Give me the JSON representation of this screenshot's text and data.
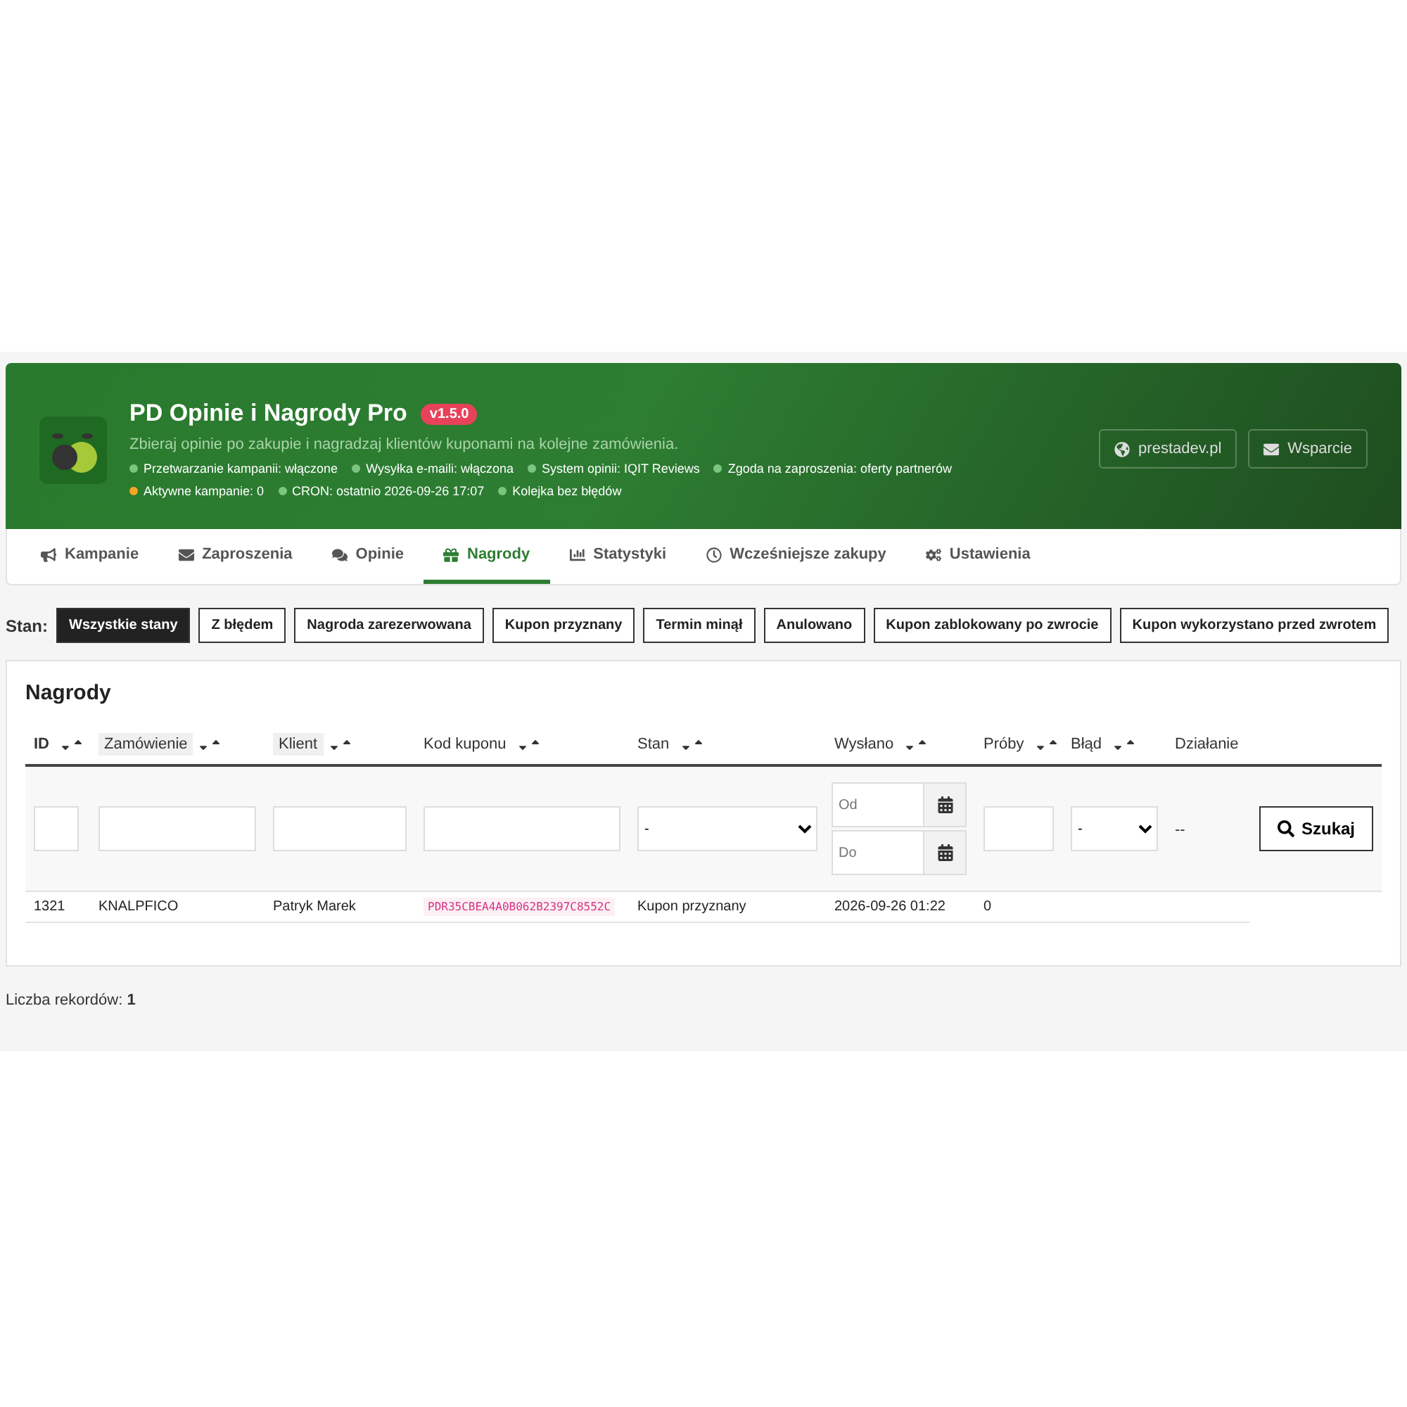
{
  "header": {
    "title": "PD Opinie i Nagrody Pro",
    "version": "v1.5.0",
    "subtitle": "Zbieraj opinie po zakupie i nagradzaj klientów kuponami na kolejne zamówienia.",
    "status_lines": [
      [
        {
          "text": "Przetwarzanie kampanii: włączone",
          "color": "#7bc67e"
        },
        {
          "text": "Wysyłka e-maili: włączona",
          "color": "#7bc67e"
        },
        {
          "text": "System opinii: IQIT Reviews",
          "color": "#7bc67e"
        },
        {
          "text": "Zgoda na zaproszenia: oferty partnerów",
          "color": "#7bc67e"
        }
      ],
      [
        {
          "text": "Aktywne kampanie: 0",
          "color": "#f5a623"
        },
        {
          "text": "CRON: ostatnio 2026-09-26 17:07",
          "color": "#7bc67e"
        },
        {
          "text": "Kolejka bez błędów",
          "color": "#7bc67e"
        }
      ]
    ],
    "links": [
      {
        "label": "prestadev.pl",
        "kind": "globe"
      },
      {
        "label": "Wsparcie",
        "kind": "mail"
      }
    ]
  },
  "tabs": [
    {
      "label": "Kampanie",
      "kind": "bullhorn",
      "selected": false
    },
    {
      "label": "Zaproszenia",
      "kind": "mail",
      "selected": false
    },
    {
      "label": "Opinie",
      "kind": "comments",
      "selected": false
    },
    {
      "label": "Nagrody",
      "kind": "gift",
      "selected": true
    },
    {
      "label": "Statystyki",
      "kind": "chart",
      "selected": false
    },
    {
      "label": "Wcześniejsze zakupy",
      "kind": "clock",
      "selected": false
    },
    {
      "label": "Ustawienia",
      "kind": "cogs",
      "selected": false
    }
  ],
  "filter_bar": {
    "label": "Stan:",
    "states": [
      {
        "label": "Wszystkie stany",
        "selected": true
      },
      {
        "label": "Z błędem",
        "selected": false
      },
      {
        "label": "Nagroda zarezerwowana",
        "selected": false
      },
      {
        "label": "Kupon przyznany",
        "selected": false
      },
      {
        "label": "Termin minął",
        "selected": false
      },
      {
        "label": "Anulowano",
        "selected": false
      },
      {
        "label": "Kupon zablokowany po zwrocie",
        "selected": false
      },
      {
        "label": "Kupon wykorzystano przed zwrotem",
        "selected": false
      }
    ]
  },
  "panel": {
    "title": "Nagrody",
    "columns": [
      {
        "label": "ID",
        "sortable": true,
        "highlighted": false,
        "bold": true
      },
      {
        "label": "Zamówienie",
        "sortable": true,
        "highlighted": true,
        "bold": false
      },
      {
        "label": "Klient",
        "sortable": true,
        "highlighted": true,
        "bold": false
      },
      {
        "label": "Kod kuponu",
        "sortable": true,
        "highlighted": false,
        "bold": false
      },
      {
        "label": "Stan",
        "sortable": true,
        "highlighted": false,
        "bold": false
      },
      {
        "label": "Wysłano",
        "sortable": true,
        "highlighted": false,
        "bold": false
      },
      {
        "label": "Próby",
        "sortable": true,
        "highlighted": false,
        "bold": false
      },
      {
        "label": "Błąd",
        "sortable": true,
        "highlighted": false,
        "bold": false
      },
      {
        "label": "Działanie",
        "sortable": false,
        "highlighted": false,
        "bold": false
      }
    ],
    "filters": [
      {
        "kind": "text"
      },
      {
        "kind": "text"
      },
      {
        "kind": "text"
      },
      {
        "kind": "text"
      },
      {
        "kind": "select",
        "value": "-"
      },
      {
        "kind": "daterange",
        "from_placeholder": "Od",
        "to_placeholder": "Do"
      },
      {
        "kind": "text"
      },
      {
        "kind": "select",
        "value": "-"
      },
      {
        "kind": "label",
        "text": "--"
      },
      {
        "kind": "button",
        "label": "Szukaj"
      }
    ],
    "rows": [
      {
        "id": "1321",
        "order": "KNALPFICO",
        "customer": "Patryk Marek",
        "coupon": "PDR35CBEA4A0B062B2397C8552C",
        "state": "Kupon przyznany",
        "sent": "2026-09-26 01:22",
        "attempts": "0"
      }
    ]
  },
  "footer": {
    "label": "Liczba rekordów:",
    "count": "1"
  }
}
